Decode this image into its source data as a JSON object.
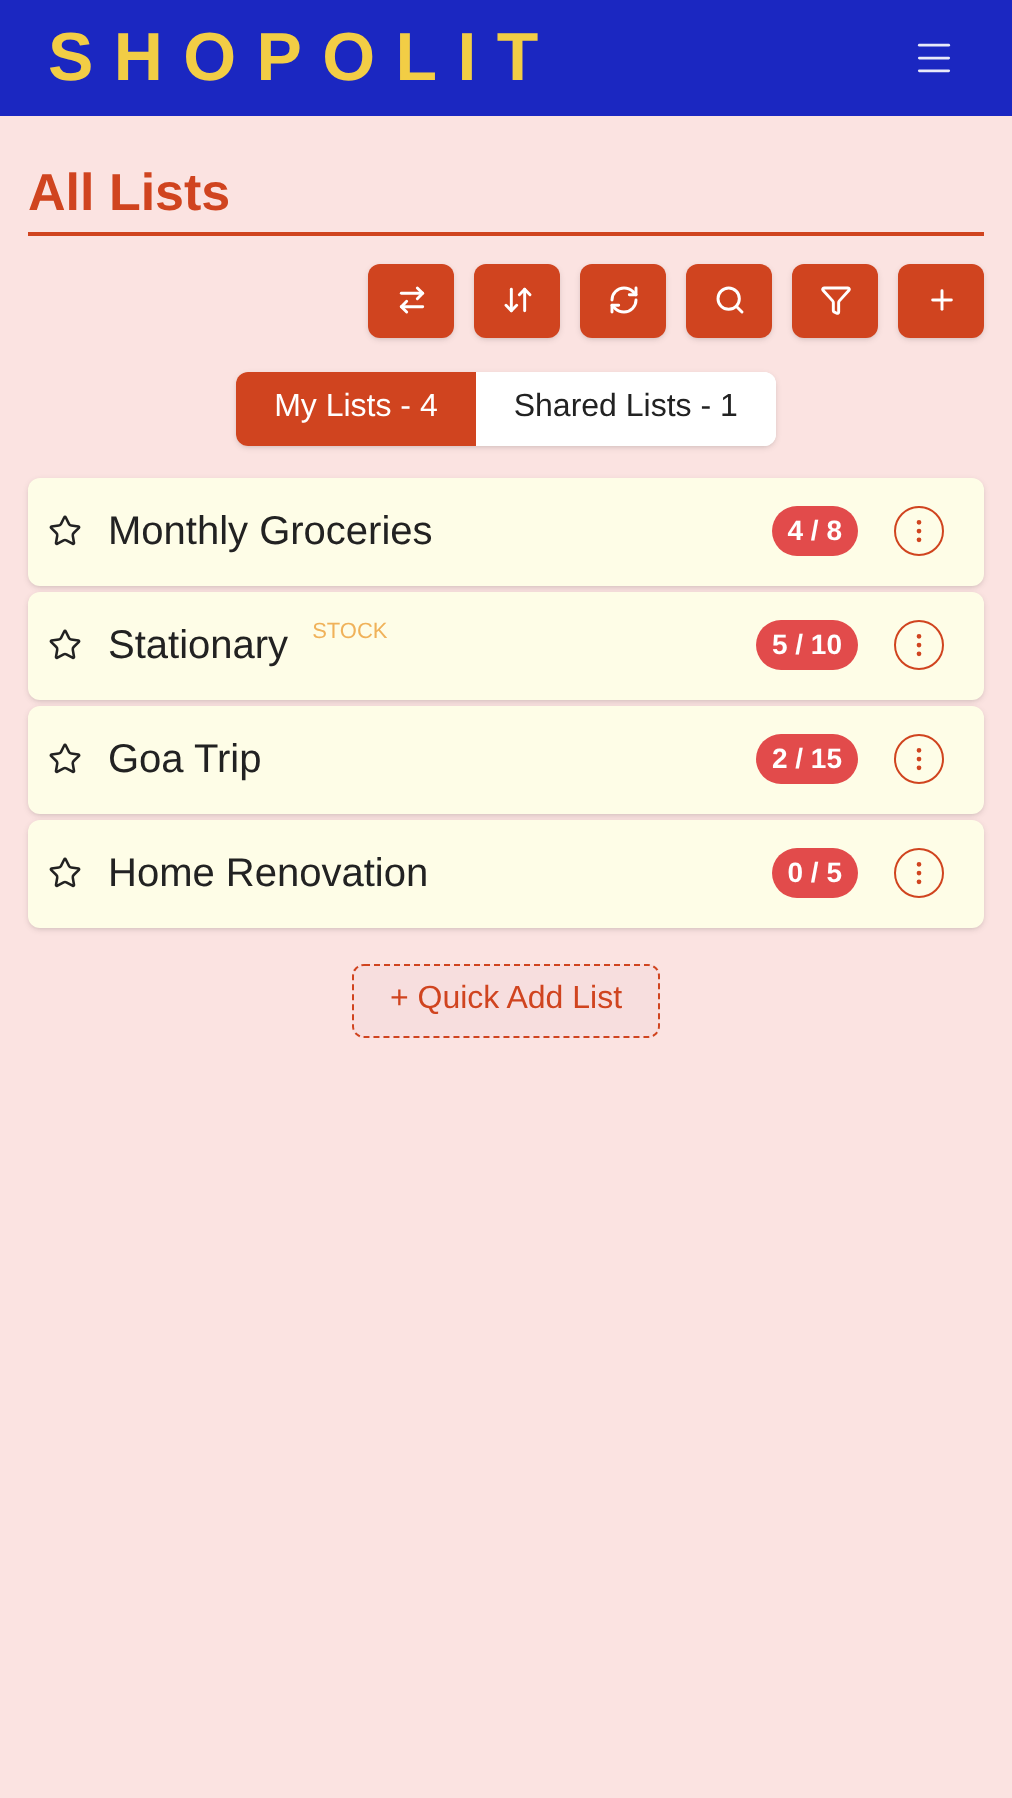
{
  "header": {
    "logo": "SHOPOLIT"
  },
  "page_title": "All Lists",
  "tabs": [
    {
      "label": "My Lists - 4",
      "selected": true
    },
    {
      "label": "Shared Lists - 1",
      "selected": false
    }
  ],
  "lists": [
    {
      "name": "Monthly Groceries",
      "starred": false,
      "count": "4 / 8"
    },
    {
      "name": "Stationary",
      "tag": "STOCK",
      "starred": false,
      "count": "5 / 10"
    },
    {
      "name": "Goa Trip",
      "starred": false,
      "count": "2 / 15"
    },
    {
      "name": "Home Renovation",
      "starred": false,
      "count": "0 / 5"
    }
  ],
  "quick_add": "+ Quick Add List"
}
